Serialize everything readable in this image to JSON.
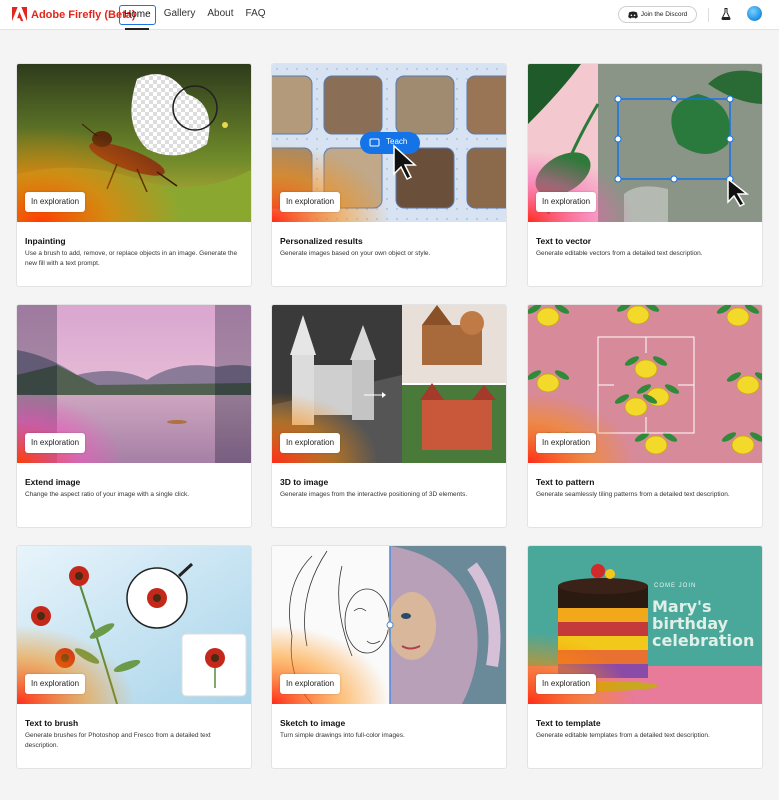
{
  "app": {
    "logo_text": "Adobe Firefly (Beta)",
    "brand_color": "#e4251b"
  },
  "nav": {
    "items": [
      {
        "label": "Home",
        "active": true
      },
      {
        "label": "Gallery"
      },
      {
        "label": "About"
      },
      {
        "label": "FAQ"
      }
    ]
  },
  "header_actions": {
    "discord_label": "Join the Discord",
    "lab_icon": "flask-icon",
    "avatar": "user-avatar"
  },
  "cards": [
    {
      "title": "Inpainting",
      "desc": "Use a brush to add, remove, or replace objects in an image. Generate the new fill with a text prompt.",
      "badge": "In exploration"
    },
    {
      "title": "Personalized results",
      "desc": "Generate images based on your own object or style.",
      "badge": "In exploration",
      "overlay_label": "Teach"
    },
    {
      "title": "Text to vector",
      "desc": "Generate editable vectors from a detailed text description.",
      "badge": "In exploration"
    },
    {
      "title": "Extend image",
      "desc": "Change the aspect ratio of your image with a single click.",
      "badge": "In exploration"
    },
    {
      "title": "3D to image",
      "desc": "Generate images from the interactive positioning of 3D elements.",
      "badge": "In exploration"
    },
    {
      "title": "Text to pattern",
      "desc": "Generate seamlessly tiling patterns from a detailed text description.",
      "badge": "In exploration"
    },
    {
      "title": "Text to brush",
      "desc": "Generate brushes for Photoshop and Fresco from a detailed text description.",
      "badge": "In exploration"
    },
    {
      "title": "Sketch to image",
      "desc": "Turn simple drawings into full-color images.",
      "badge": "In exploration"
    },
    {
      "title": "Text to template",
      "desc": "Generate editable templates from a detailed text description.",
      "badge": "In exploration",
      "overlay_small": "COME JOIN",
      "overlay_large": [
        "Mary's",
        "birthday",
        "celebration"
      ]
    }
  ]
}
